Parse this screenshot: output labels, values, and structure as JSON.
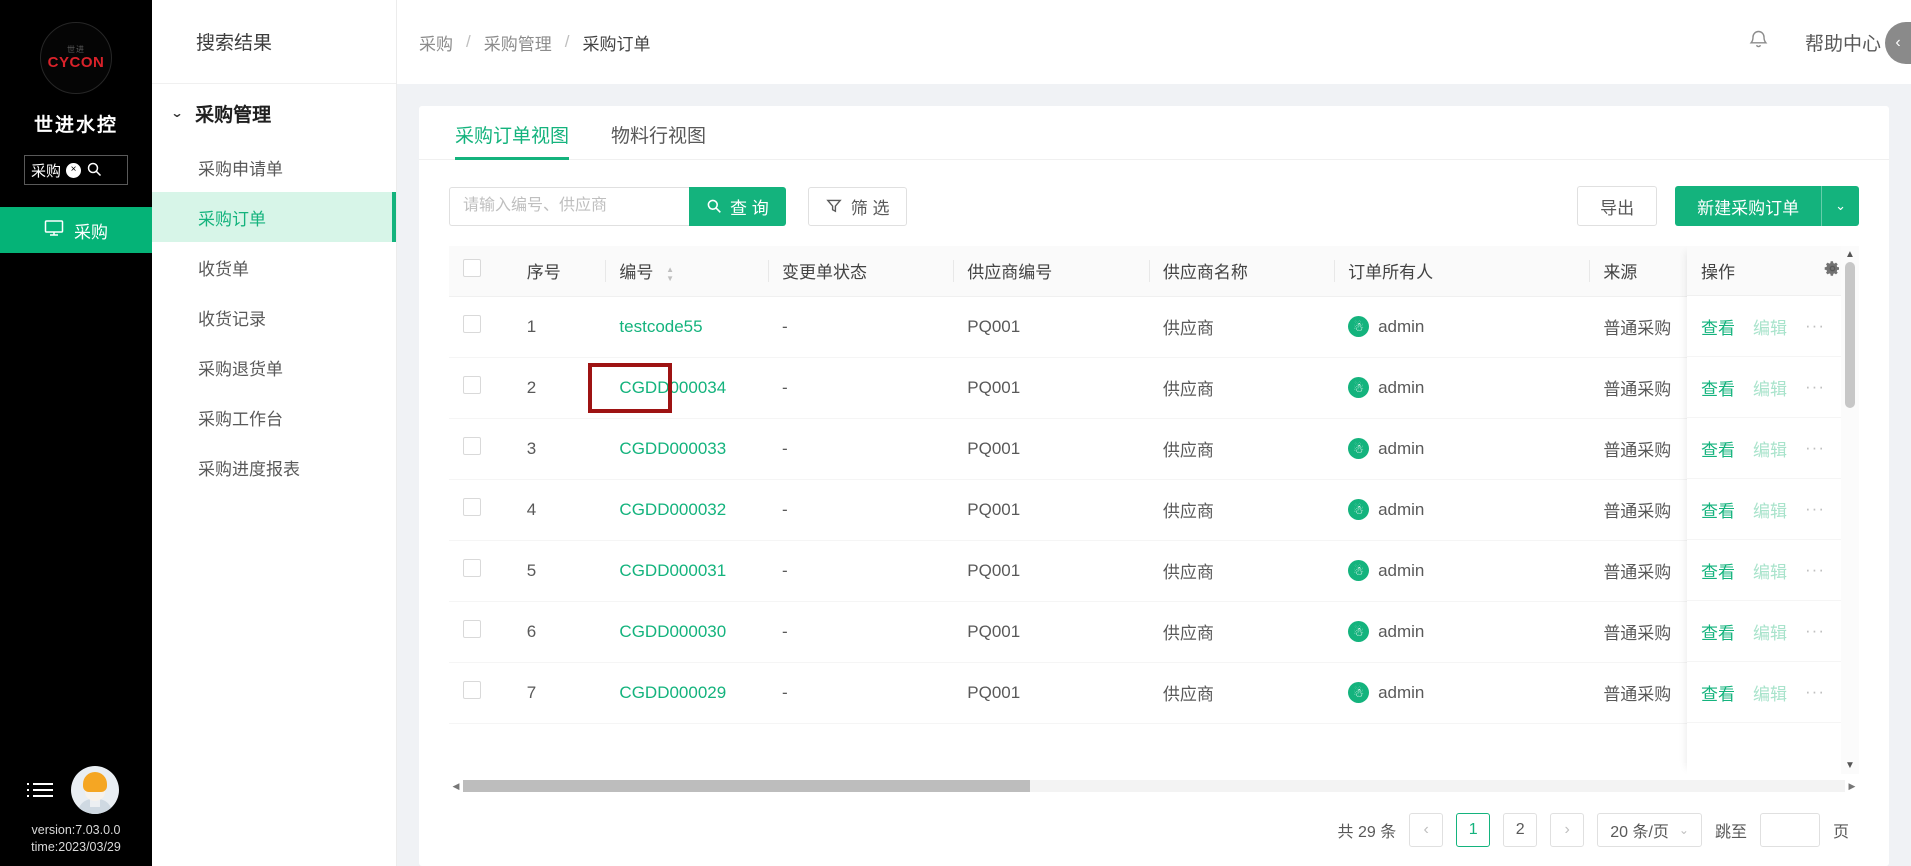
{
  "rail": {
    "logo_top": "世进",
    "logo_main": "CYCON",
    "brand": "世进水控",
    "search_value": "采购",
    "clear_icon": "×",
    "search_icon": "⌕",
    "nav_item": "采购",
    "nav_icon": "monitor-icon",
    "version": "version:7.03.0.0",
    "time": "time:2023/03/29"
  },
  "submenu": {
    "title": "搜索结果",
    "group": "采购管理",
    "items": [
      {
        "label": "采购申请单",
        "active": false
      },
      {
        "label": "采购订单",
        "active": true
      },
      {
        "label": "收货单",
        "active": false
      },
      {
        "label": "收货记录",
        "active": false
      },
      {
        "label": "采购退货单",
        "active": false
      },
      {
        "label": "采购工作台",
        "active": false
      },
      {
        "label": "采购进度报表",
        "active": false
      }
    ]
  },
  "topbar": {
    "breadcrumb": [
      "采购",
      "采购管理",
      "采购订单"
    ],
    "separator": "/",
    "bell_icon": "bell-icon",
    "help": "帮助中心",
    "collapse_icon": "‹"
  },
  "tabs": [
    {
      "label": "采购订单视图",
      "active": true
    },
    {
      "label": "物料行视图",
      "active": false
    }
  ],
  "toolbar": {
    "search_placeholder": "请输入编号、供应商",
    "search_value": "",
    "search_button": "查 询",
    "search_icon": "⌕",
    "filter_button": "筛 选",
    "filter_icon": "filter-icon",
    "export_button": "导出",
    "new_button": "新建采购订单",
    "new_dropdown_icon": "⌄"
  },
  "table": {
    "columns": [
      "序号",
      "编号",
      "变更单状态",
      "供应商编号",
      "供应商名称",
      "订单所有人",
      "来源"
    ],
    "action_column": "操作",
    "settings_icon": "gear-icon",
    "sort_icon": "sort-icon",
    "rows": [
      {
        "no": "1",
        "code": "testcode55",
        "change_status": "-",
        "supplier_code": "PQ001",
        "supplier_name": "供应商",
        "owner": "admin",
        "source": "普通采购"
      },
      {
        "no": "2",
        "code": "CGDD000034",
        "change_status": "-",
        "supplier_code": "PQ001",
        "supplier_name": "供应商",
        "owner": "admin",
        "source": "普通采购"
      },
      {
        "no": "3",
        "code": "CGDD000033",
        "change_status": "-",
        "supplier_code": "PQ001",
        "supplier_name": "供应商",
        "owner": "admin",
        "source": "普通采购"
      },
      {
        "no": "4",
        "code": "CGDD000032",
        "change_status": "-",
        "supplier_code": "PQ001",
        "supplier_name": "供应商",
        "owner": "admin",
        "source": "普通采购"
      },
      {
        "no": "5",
        "code": "CGDD000031",
        "change_status": "-",
        "supplier_code": "PQ001",
        "supplier_name": "供应商",
        "owner": "admin",
        "source": "普通采购"
      },
      {
        "no": "6",
        "code": "CGDD000030",
        "change_status": "-",
        "supplier_code": "PQ001",
        "supplier_name": "供应商",
        "owner": "admin",
        "source": "普通采购"
      },
      {
        "no": "7",
        "code": "CGDD000029",
        "change_status": "-",
        "supplier_code": "PQ001",
        "supplier_name": "供应商",
        "owner": "admin",
        "source": "普通采购"
      }
    ],
    "actions": {
      "view": "查看",
      "edit": "编辑",
      "more": "···"
    }
  },
  "pagination": {
    "total": "共 29 条",
    "prev": "‹",
    "pages": [
      "1",
      "2"
    ],
    "current": "1",
    "next": "›",
    "page_size": "20 条/页",
    "page_size_caret": "⌄",
    "jump_label": "跳至",
    "jump_value": "",
    "jump_suffix": "页"
  },
  "annotation": {
    "target_code": "CGDD000034",
    "color": "#9e1313"
  },
  "colors": {
    "accent": "#14b37d",
    "rail_bg": "#000000",
    "annotation": "#9e1313"
  }
}
